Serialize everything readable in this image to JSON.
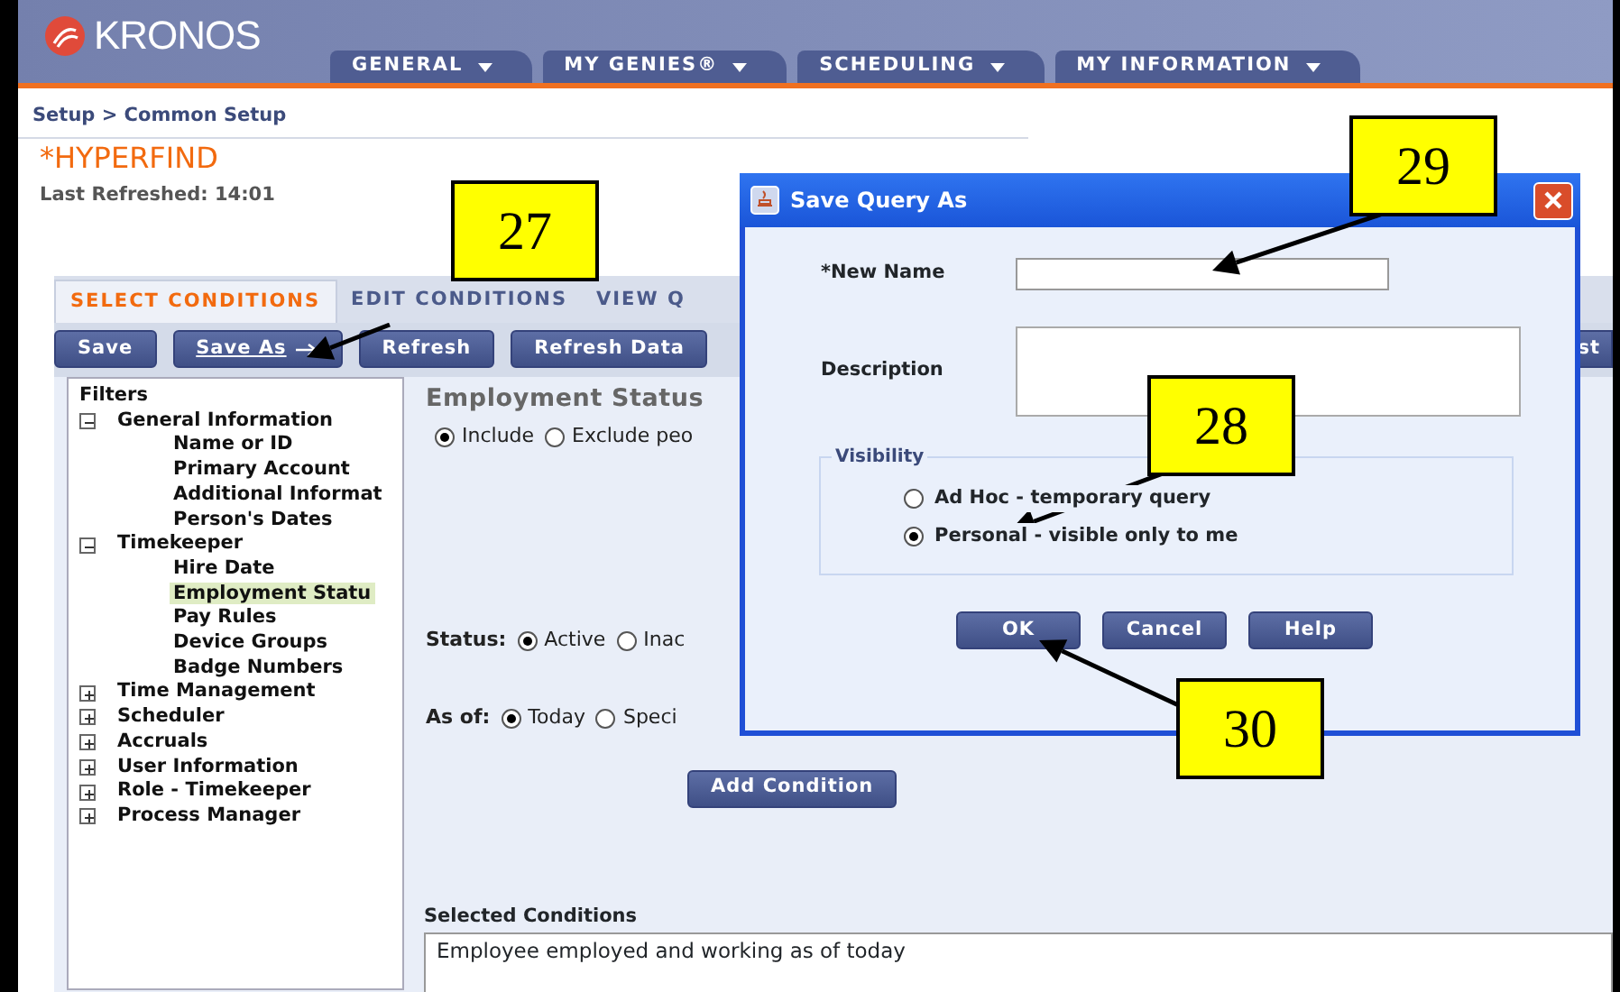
{
  "brand": {
    "name": "KRONOS"
  },
  "nav_tabs": [
    {
      "label": "GENERAL"
    },
    {
      "label": "MY GENIES®"
    },
    {
      "label": "SCHEDULING"
    },
    {
      "label": "MY INFORMATION"
    }
  ],
  "breadcrumb": "Setup > Common Setup",
  "page_title": "*HYPERFIND",
  "last_refreshed": "Last Refreshed: 14:01",
  "tabs": [
    {
      "label": "SELECT CONDITIONS",
      "selected": true
    },
    {
      "label": "EDIT CONDITIONS",
      "selected": false
    },
    {
      "label": "VIEW Q",
      "selected": false
    }
  ],
  "toolbar": [
    {
      "label": "Save",
      "kind": "plain"
    },
    {
      "label": "Save As",
      "kind": "menu"
    },
    {
      "label": "Refresh",
      "kind": "plain"
    },
    {
      "label": "Refresh Data",
      "kind": "plain"
    },
    {
      "label": "st",
      "kind": "edge"
    }
  ],
  "filters": {
    "title": "Filters",
    "items": [
      {
        "label": "General Information",
        "expanded": true,
        "children": [
          {
            "label": "Name or ID",
            "selected": false
          },
          {
            "label": "Primary Account",
            "selected": false
          },
          {
            "label": "Additional Informat",
            "selected": false
          },
          {
            "label": "Person's Dates",
            "selected": false
          }
        ]
      },
      {
        "label": "Timekeeper",
        "expanded": true,
        "children": [
          {
            "label": "Hire Date",
            "selected": false
          },
          {
            "label": "Employment Statu",
            "selected": true
          },
          {
            "label": "Pay Rules",
            "selected": false
          },
          {
            "label": "Device Groups",
            "selected": false
          },
          {
            "label": "Badge Numbers",
            "selected": false
          }
        ]
      },
      {
        "label": "Time Management",
        "expanded": false
      },
      {
        "label": "Scheduler",
        "expanded": false
      },
      {
        "label": "Accruals",
        "expanded": false
      },
      {
        "label": "User Information",
        "expanded": false
      },
      {
        "label": "Role - Timekeeper",
        "expanded": false
      },
      {
        "label": "Process Manager",
        "expanded": false
      }
    ]
  },
  "condition": {
    "title": "Employment Status",
    "include": [
      {
        "label": "Include",
        "selected": true
      },
      {
        "label": "Exclude peo",
        "selected": false
      }
    ],
    "status": {
      "label": "Status:",
      "options": [
        {
          "label": "Active",
          "selected": true
        },
        {
          "label": "Inac",
          "selected": false
        }
      ]
    },
    "as_of": {
      "label": "As of:",
      "options": [
        {
          "label": "Today",
          "selected": true
        },
        {
          "label": "Speci",
          "selected": false
        }
      ]
    },
    "add_button": "Add Condition"
  },
  "selected_conditions": {
    "label": "Selected Conditions",
    "value": "Employee employed and working as of today"
  },
  "dialog": {
    "title": "Save Query As",
    "fields": [
      {
        "label": "*New Name",
        "kind": "line"
      },
      {
        "label": "Description",
        "kind": "area"
      }
    ],
    "visibility": {
      "title": "Visibility",
      "options": [
        {
          "label": "Ad Hoc - temporary query",
          "selected": false
        },
        {
          "label": "Personal - visible only to me",
          "selected": true
        }
      ]
    },
    "buttons": [
      "OK",
      "Cancel",
      "Help"
    ]
  },
  "callouts": [
    {
      "label": "27"
    },
    {
      "label": "29"
    },
    {
      "label": "28"
    },
    {
      "label": "30"
    }
  ]
}
